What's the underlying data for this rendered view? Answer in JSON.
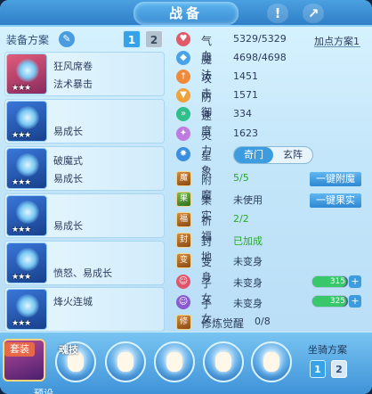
{
  "title": "战备",
  "title_buttons": {
    "help": "!",
    "share": "↗"
  },
  "left": {
    "plan_label": "装备方案",
    "plan_tabs": [
      "1",
      "2"
    ],
    "items": [
      {
        "line1": "狂风席卷",
        "line2": "法术暴击",
        "stars": "★★★",
        "icon": "red-sword-icon"
      },
      {
        "line1": "",
        "line2": "易成长",
        "stars": "★★★",
        "icon": "blue-helmet-icon"
      },
      {
        "line1": "破魔式",
        "line2": "易成长",
        "stars": "★★★",
        "icon": "blue-necklace-icon"
      },
      {
        "line1": "",
        "line2": "易成长",
        "stars": "★★★",
        "icon": "blue-armor-icon"
      },
      {
        "line1": "",
        "line2": "愤怒、易成长",
        "stars": "★★★",
        "icon": "blue-belt-icon"
      },
      {
        "line1": "烽火连城",
        "line2": "",
        "stars": "★★★",
        "icon": "blue-boots-icon"
      }
    ]
  },
  "stats": {
    "add_point": "加点方案1",
    "rows": [
      {
        "label": "气血",
        "value": "5329/5329",
        "color": "#e05a6a"
      },
      {
        "label": "魔法",
        "value": "4698/4698",
        "color": "#4aa3e8"
      },
      {
        "label": "攻击",
        "value": "1451",
        "color": "#ef8a3a"
      },
      {
        "label": "防御",
        "value": "1571",
        "color": "#f0a23a"
      },
      {
        "label": "速度",
        "value": "334",
        "color": "#2fbf8a"
      },
      {
        "label": "灵力",
        "value": "1623",
        "color": "#c07be0"
      }
    ],
    "xingxiang": {
      "label": "星象",
      "options": [
        "奇门",
        "玄阵"
      ]
    }
  },
  "extras": [
    {
      "label": "附魔",
      "value": "5/5",
      "green": true
    },
    {
      "label": "果实",
      "value": "未使用",
      "green": false
    },
    {
      "label": "祈福",
      "value": "2/2",
      "green": true
    },
    {
      "label": "封地",
      "value": "已加成",
      "green": true
    },
    {
      "label": "变身",
      "value": "未变身",
      "green": false
    },
    {
      "label": "子女",
      "value": "未变身",
      "green": false
    },
    {
      "label": "子女",
      "value": "未变身",
      "green": false
    },
    {
      "label": "修炼觉醒",
      "value": "0/8",
      "green": false
    }
  ],
  "actions": {
    "enchant": "一键附魔",
    "fruit": "一键果实"
  },
  "child_levels": [
    {
      "value": "315",
      "fill": 0.95
    },
    {
      "value": "325",
      "fill": 0.95
    }
  ],
  "bottom": {
    "taozhuang": "套装",
    "hunji": "魂技",
    "mount_label": "坐骑方案",
    "mount_tabs": [
      "1",
      "2"
    ],
    "cut_label": "预设"
  }
}
